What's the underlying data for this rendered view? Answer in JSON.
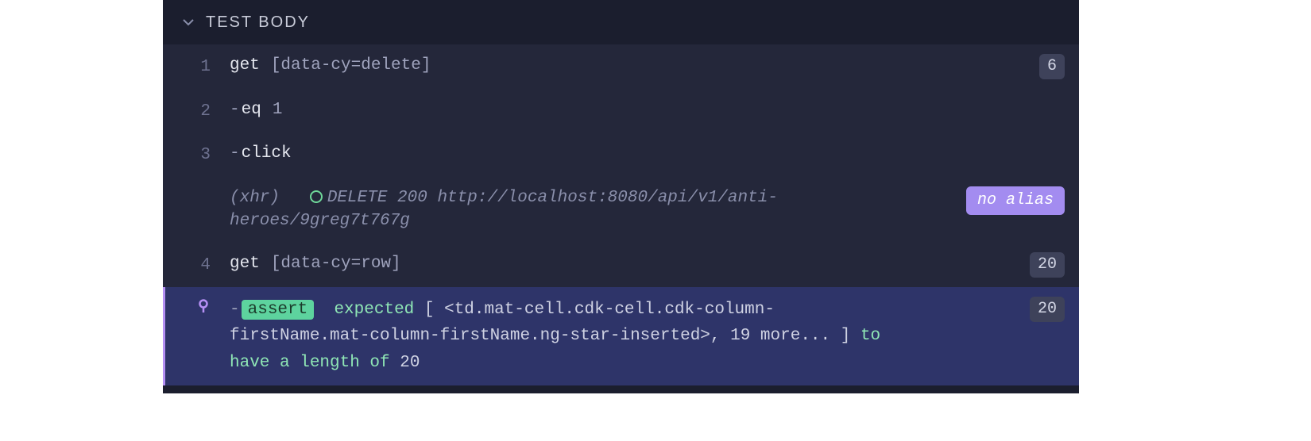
{
  "header": {
    "title": "TEST BODY"
  },
  "rows": [
    {
      "num": "1",
      "command": "get",
      "selector": "[data-cy=delete]",
      "badge": "6"
    },
    {
      "num": "2",
      "prefix": "-",
      "command": "eq",
      "arg": "1"
    },
    {
      "num": "3",
      "prefix": "-",
      "command": "click"
    },
    {
      "type": "xhr",
      "label": "(xhr)",
      "method_status_url": "DELETE 200 http://localhost:8080/api/v1/anti-heroes/9greg7t767g",
      "alias": "no alias"
    },
    {
      "num": "4",
      "command": "get",
      "selector": "[data-cy=row]",
      "badge": "20"
    },
    {
      "type": "assert",
      "pill": "assert",
      "prefix": "-",
      "text_pre": "expected ",
      "subject_open": "[ ",
      "subject": "<td.mat-cell.cdk-cell.cdk-column-firstName.mat-column-firstName.ng-star-inserted>, 19 more...",
      "subject_close": " ]",
      "text_mid": " to have a length of ",
      "value": "20",
      "badge": "20"
    }
  ]
}
